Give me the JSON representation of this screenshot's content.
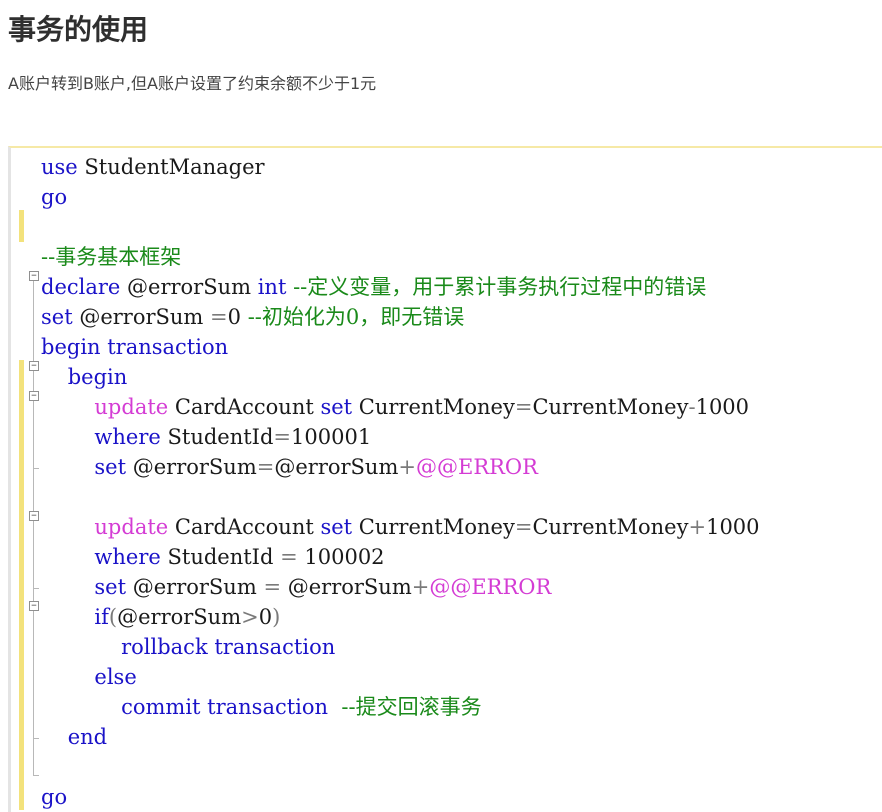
{
  "page": {
    "title": "事务的使用",
    "description": "A账户转到B账户,但A账户设置了约束余额不少于1元"
  },
  "code": {
    "lines": [
      [
        {
          "t": "use",
          "c": "kw"
        },
        {
          "t": " StudentManager",
          "c": "pl"
        }
      ],
      [
        {
          "t": "go",
          "c": "kw"
        }
      ],
      [],
      [
        {
          "t": "--事务基本框架",
          "c": "cm"
        }
      ],
      [
        {
          "t": "declare",
          "c": "kw"
        },
        {
          "t": " @errorSum ",
          "c": "pl"
        },
        {
          "t": "int",
          "c": "kw"
        },
        {
          "t": " --定义变量，用于累计事务执行过程中的错误",
          "c": "cm"
        }
      ],
      [
        {
          "t": "set",
          "c": "kw"
        },
        {
          "t": " @errorSum ",
          "c": "pl"
        },
        {
          "t": "=",
          "c": "op"
        },
        {
          "t": "0 ",
          "c": "pl"
        },
        {
          "t": "--初始化为0，即无错误",
          "c": "cm"
        }
      ],
      [
        {
          "t": "begin transaction",
          "c": "kw"
        }
      ],
      [
        {
          "t": "    begin",
          "c": "kw"
        }
      ],
      [
        {
          "t": "        ",
          "c": "pl"
        },
        {
          "t": "update",
          "c": "sys"
        },
        {
          "t": " CardAccount ",
          "c": "pl"
        },
        {
          "t": "set",
          "c": "kw"
        },
        {
          "t": " CurrentMoney",
          "c": "pl"
        },
        {
          "t": "=",
          "c": "op"
        },
        {
          "t": "CurrentMoney",
          "c": "pl"
        },
        {
          "t": "-",
          "c": "op"
        },
        {
          "t": "1000",
          "c": "pl"
        }
      ],
      [
        {
          "t": "        ",
          "c": "pl"
        },
        {
          "t": "where",
          "c": "kw"
        },
        {
          "t": " StudentId",
          "c": "pl"
        },
        {
          "t": "=",
          "c": "op"
        },
        {
          "t": "100001",
          "c": "pl"
        }
      ],
      [
        {
          "t": "        ",
          "c": "pl"
        },
        {
          "t": "set",
          "c": "kw"
        },
        {
          "t": " @errorSum",
          "c": "pl"
        },
        {
          "t": "=",
          "c": "op"
        },
        {
          "t": "@errorSum",
          "c": "pl"
        },
        {
          "t": "+",
          "c": "op"
        },
        {
          "t": "@@ERROR",
          "c": "sys"
        }
      ],
      [],
      [
        {
          "t": "        ",
          "c": "pl"
        },
        {
          "t": "update",
          "c": "sys"
        },
        {
          "t": " CardAccount ",
          "c": "pl"
        },
        {
          "t": "set",
          "c": "kw"
        },
        {
          "t": " CurrentMoney",
          "c": "pl"
        },
        {
          "t": "=",
          "c": "op"
        },
        {
          "t": "CurrentMoney",
          "c": "pl"
        },
        {
          "t": "+",
          "c": "op"
        },
        {
          "t": "1000",
          "c": "pl"
        }
      ],
      [
        {
          "t": "        ",
          "c": "pl"
        },
        {
          "t": "where",
          "c": "kw"
        },
        {
          "t": " StudentId ",
          "c": "pl"
        },
        {
          "t": "=",
          "c": "op"
        },
        {
          "t": " 100002",
          "c": "pl"
        }
      ],
      [
        {
          "t": "        ",
          "c": "pl"
        },
        {
          "t": "set",
          "c": "kw"
        },
        {
          "t": " @errorSum ",
          "c": "pl"
        },
        {
          "t": "=",
          "c": "op"
        },
        {
          "t": " @errorSum",
          "c": "pl"
        },
        {
          "t": "+",
          "c": "op"
        },
        {
          "t": "@@ERROR",
          "c": "sys"
        }
      ],
      [
        {
          "t": "        ",
          "c": "pl"
        },
        {
          "t": "if",
          "c": "kw"
        },
        {
          "t": "(",
          "c": "op"
        },
        {
          "t": "@errorSum",
          "c": "pl"
        },
        {
          "t": ">",
          "c": "op"
        },
        {
          "t": "0",
          "c": "pl"
        },
        {
          "t": ")",
          "c": "op"
        }
      ],
      [
        {
          "t": "            rollback transaction",
          "c": "kw"
        }
      ],
      [
        {
          "t": "        else",
          "c": "kw"
        }
      ],
      [
        {
          "t": "            commit transaction",
          "c": "kw"
        },
        {
          "t": "  --提交回滚事务",
          "c": "cm"
        }
      ],
      [
        {
          "t": "    end",
          "c": "kw"
        }
      ],
      [],
      [
        {
          "t": "go",
          "c": "kw"
        }
      ]
    ]
  },
  "colors": {
    "keyword": "#1a12c8",
    "comment": "#1a8a1a",
    "system": "#d43cd4",
    "operator": "#7a7a7a",
    "change_marker": "#f3e27c"
  },
  "icons": {
    "fold": "fold-minus-icon"
  }
}
